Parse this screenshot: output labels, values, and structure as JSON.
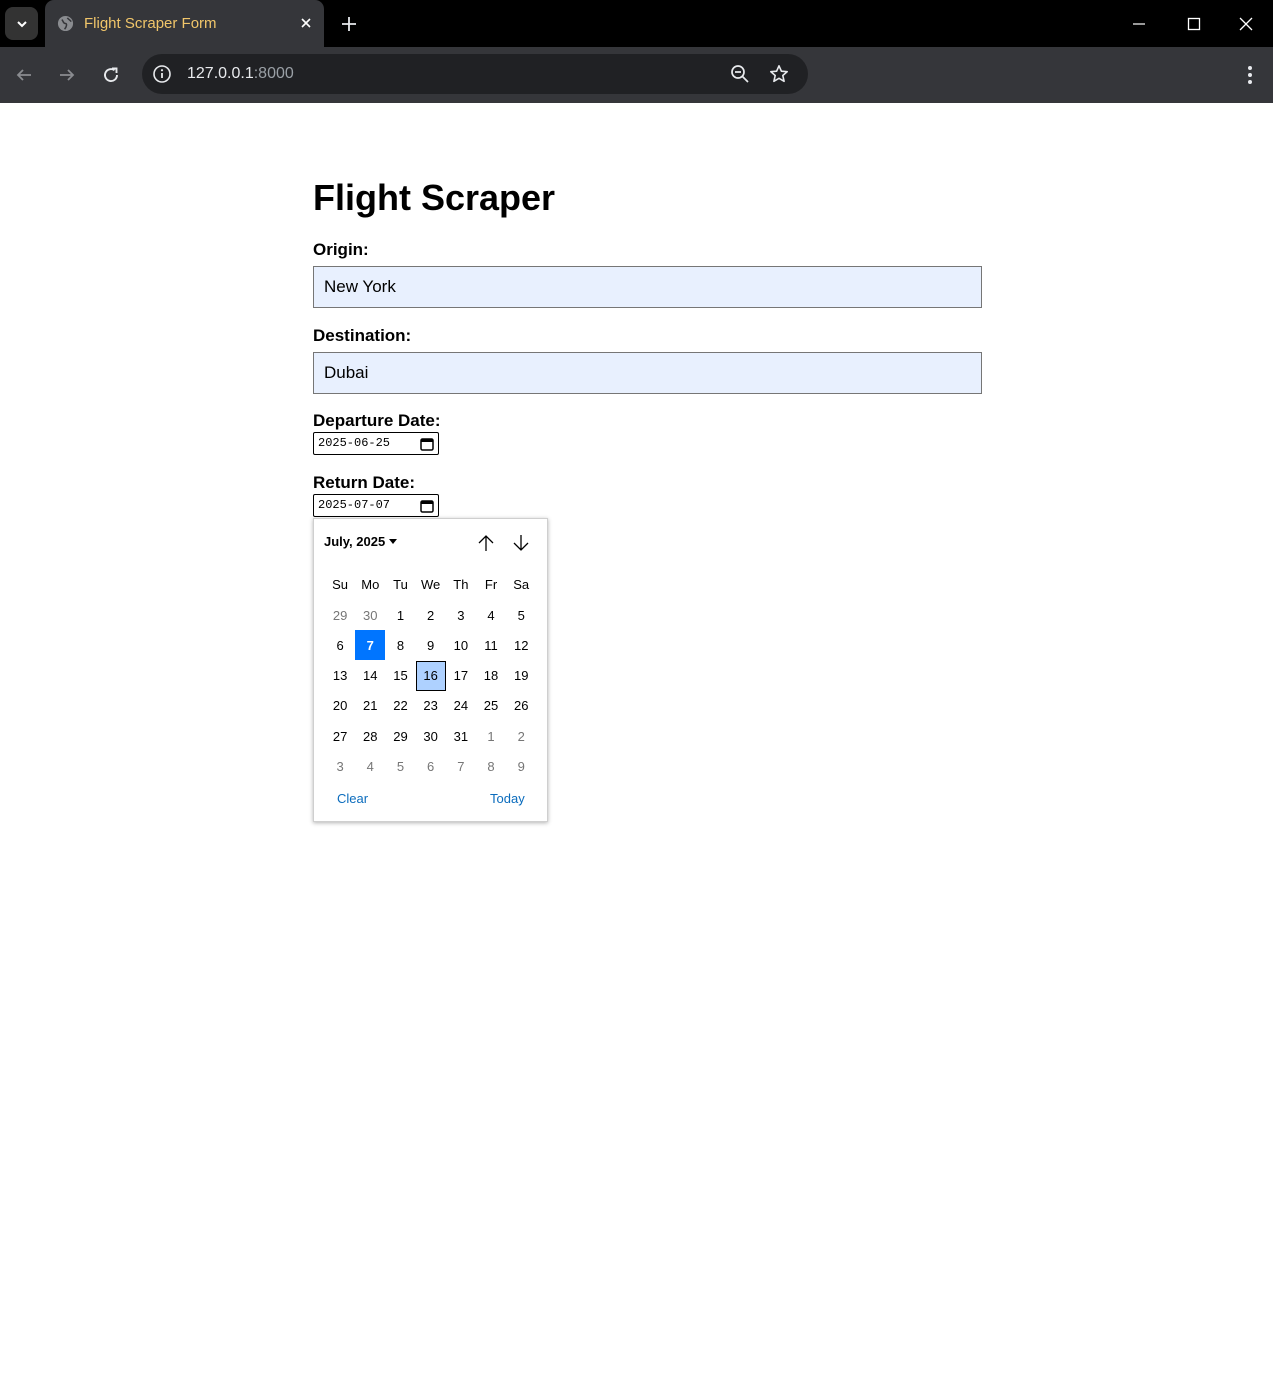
{
  "browser": {
    "tab_title": "Flight Scraper Form",
    "url_host": "127.0.0.1",
    "url_port": ":8000"
  },
  "page": {
    "heading": "Flight Scraper",
    "origin": {
      "label": "Origin:",
      "value": "New York"
    },
    "destination": {
      "label": "Destination:",
      "value": "Dubai"
    },
    "departure": {
      "label": "Departure Date:",
      "value": "2025-06-25"
    },
    "return": {
      "label": "Return Date:",
      "value": "2025-07-07"
    }
  },
  "datepicker": {
    "month_label": "July, 2025",
    "weekdays": [
      "Su",
      "Mo",
      "Tu",
      "We",
      "Th",
      "Fr",
      "Sa"
    ],
    "weeks": [
      [
        {
          "d": "29",
          "other": true
        },
        {
          "d": "30",
          "other": true
        },
        {
          "d": "1"
        },
        {
          "d": "2"
        },
        {
          "d": "3"
        },
        {
          "d": "4"
        },
        {
          "d": "5"
        }
      ],
      [
        {
          "d": "6"
        },
        {
          "d": "7",
          "selected": true
        },
        {
          "d": "8"
        },
        {
          "d": "9"
        },
        {
          "d": "10"
        },
        {
          "d": "11"
        },
        {
          "d": "12"
        }
      ],
      [
        {
          "d": "13"
        },
        {
          "d": "14"
        },
        {
          "d": "15"
        },
        {
          "d": "16",
          "today": true
        },
        {
          "d": "17"
        },
        {
          "d": "18"
        },
        {
          "d": "19"
        }
      ],
      [
        {
          "d": "20"
        },
        {
          "d": "21"
        },
        {
          "d": "22"
        },
        {
          "d": "23"
        },
        {
          "d": "24"
        },
        {
          "d": "25"
        },
        {
          "d": "26"
        }
      ],
      [
        {
          "d": "27"
        },
        {
          "d": "28"
        },
        {
          "d": "29"
        },
        {
          "d": "30"
        },
        {
          "d": "31"
        },
        {
          "d": "1",
          "other": true
        },
        {
          "d": "2",
          "other": true
        }
      ],
      [
        {
          "d": "3",
          "other": true
        },
        {
          "d": "4",
          "other": true
        },
        {
          "d": "5",
          "other": true
        },
        {
          "d": "6",
          "other": true
        },
        {
          "d": "7",
          "other": true
        },
        {
          "d": "8",
          "other": true
        },
        {
          "d": "9",
          "other": true
        }
      ]
    ],
    "clear_label": "Clear",
    "today_label": "Today"
  },
  "colors": {
    "selected": "#0075ff",
    "today_highlight": "#aed1ff",
    "autofill_bg": "#e8f0fe",
    "link": "#0b6cbd",
    "tab_title": "#f1c66a"
  }
}
